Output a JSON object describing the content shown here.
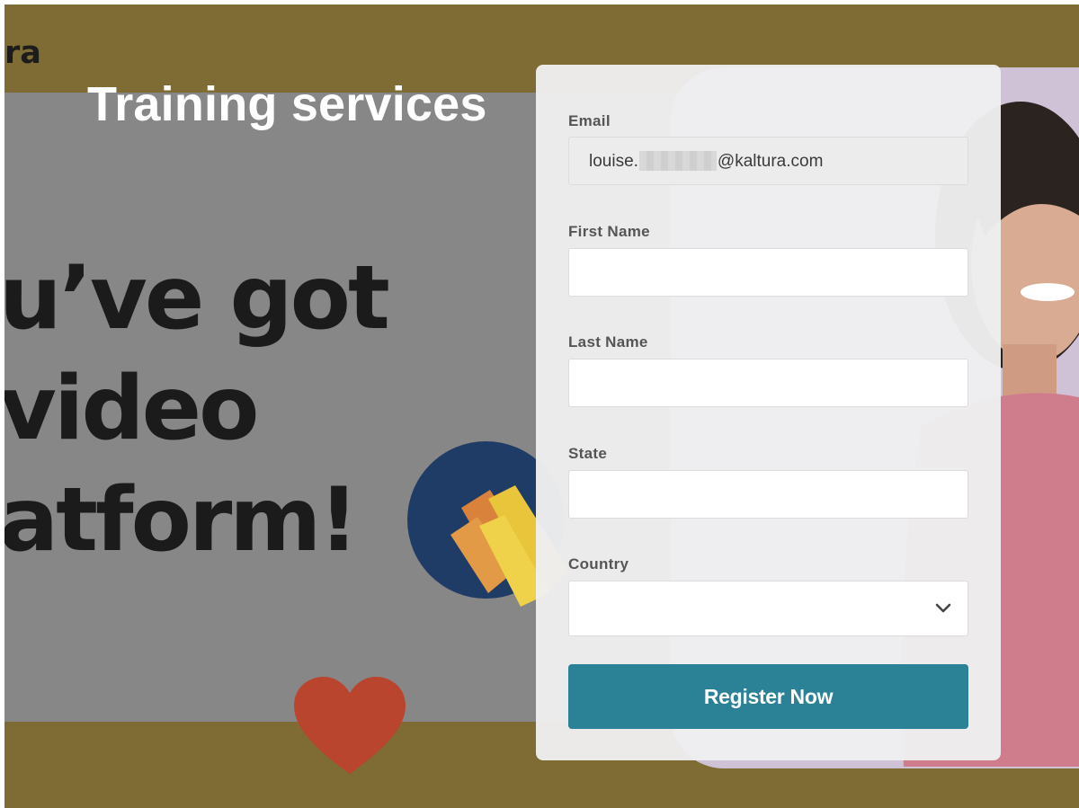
{
  "brand": {
    "logo_fragment": "ra"
  },
  "header": {
    "title": "Training services"
  },
  "hero": {
    "headline_lines": [
      "u’ve got",
      "video",
      "atform!"
    ]
  },
  "form": {
    "email": {
      "label": "Email",
      "value_prefix": "louise.",
      "value_suffix": "@kaltura.com"
    },
    "first_name": {
      "label": "First Name",
      "value": ""
    },
    "last_name": {
      "label": "Last Name",
      "value": ""
    },
    "state": {
      "label": "State",
      "value": ""
    },
    "country": {
      "label": "Country",
      "selected": ""
    },
    "submit_label": "Register Now"
  },
  "colors": {
    "page_bg": "#7e6c34",
    "hero_bg": "#878787",
    "card_bg": "#eeeef0",
    "button_bg": "#2b8195",
    "label_text": "#555555"
  },
  "icons": {
    "country_select": "chevron-down-icon"
  }
}
